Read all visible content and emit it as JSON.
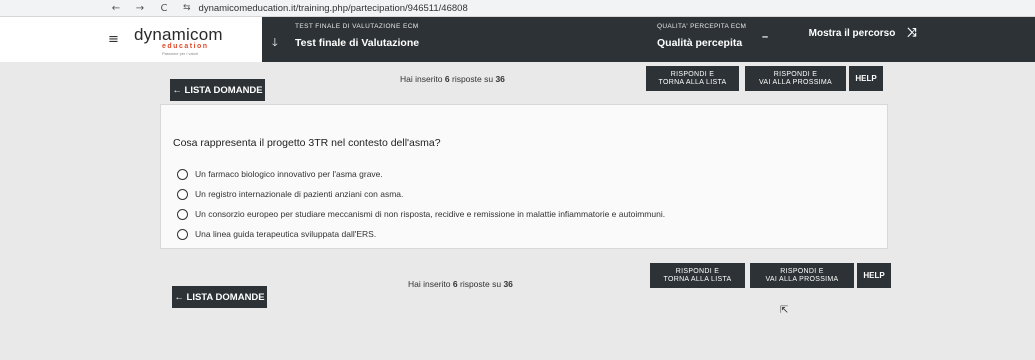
{
  "browser": {
    "back": "←",
    "forward": "→",
    "reload": "C",
    "site_info": "⇆",
    "url": "dynamicomeducation.it/training.php/partecipation/946511/46808"
  },
  "header": {
    "menu_icon": "≡",
    "logo": {
      "main": "dynamicom",
      "sub": "education",
      "tagline": "Passione per i valori"
    },
    "download_icon": "🡓",
    "kicker": "TEST FINALE DI VALUTAZIONE ECM",
    "title": "Test finale di Valutazione",
    "quality_kicker": "QUALITA' PERCEPITA ECM",
    "quality_title": "Qualità percepita",
    "dash": "–",
    "show_course": "Mostra il percorso",
    "shuffle_icon": "⤨"
  },
  "actions": {
    "back_list": "← LISTA DOMANDE",
    "inserted_prefix": "Hai inserito ",
    "inserted_count": "6",
    "inserted_mid": " risposte su ",
    "inserted_total": "36",
    "answer_list_1": "RISPONDI E",
    "answer_list_2": "TORNA ALLA LISTA",
    "answer_next_1": "RISPONDI E",
    "answer_next_2": "VAI ALLA PROSSIMA",
    "help": "HELP"
  },
  "question": {
    "text": "Cosa rappresenta il progetto 3TR nel contesto dell'asma?",
    "options": [
      "Un farmaco biologico innovativo per l'asma grave.",
      "Un registro internazionale di pazienti anziani con asma.",
      "Un consorzio europeo per studiare meccanismi di non risposta, recidive e remissione in malattie infiammatorie e autoimmuni.",
      "Una linea guida terapeutica sviluppata dall'ERS."
    ]
  },
  "cursor_icon": "⇱"
}
